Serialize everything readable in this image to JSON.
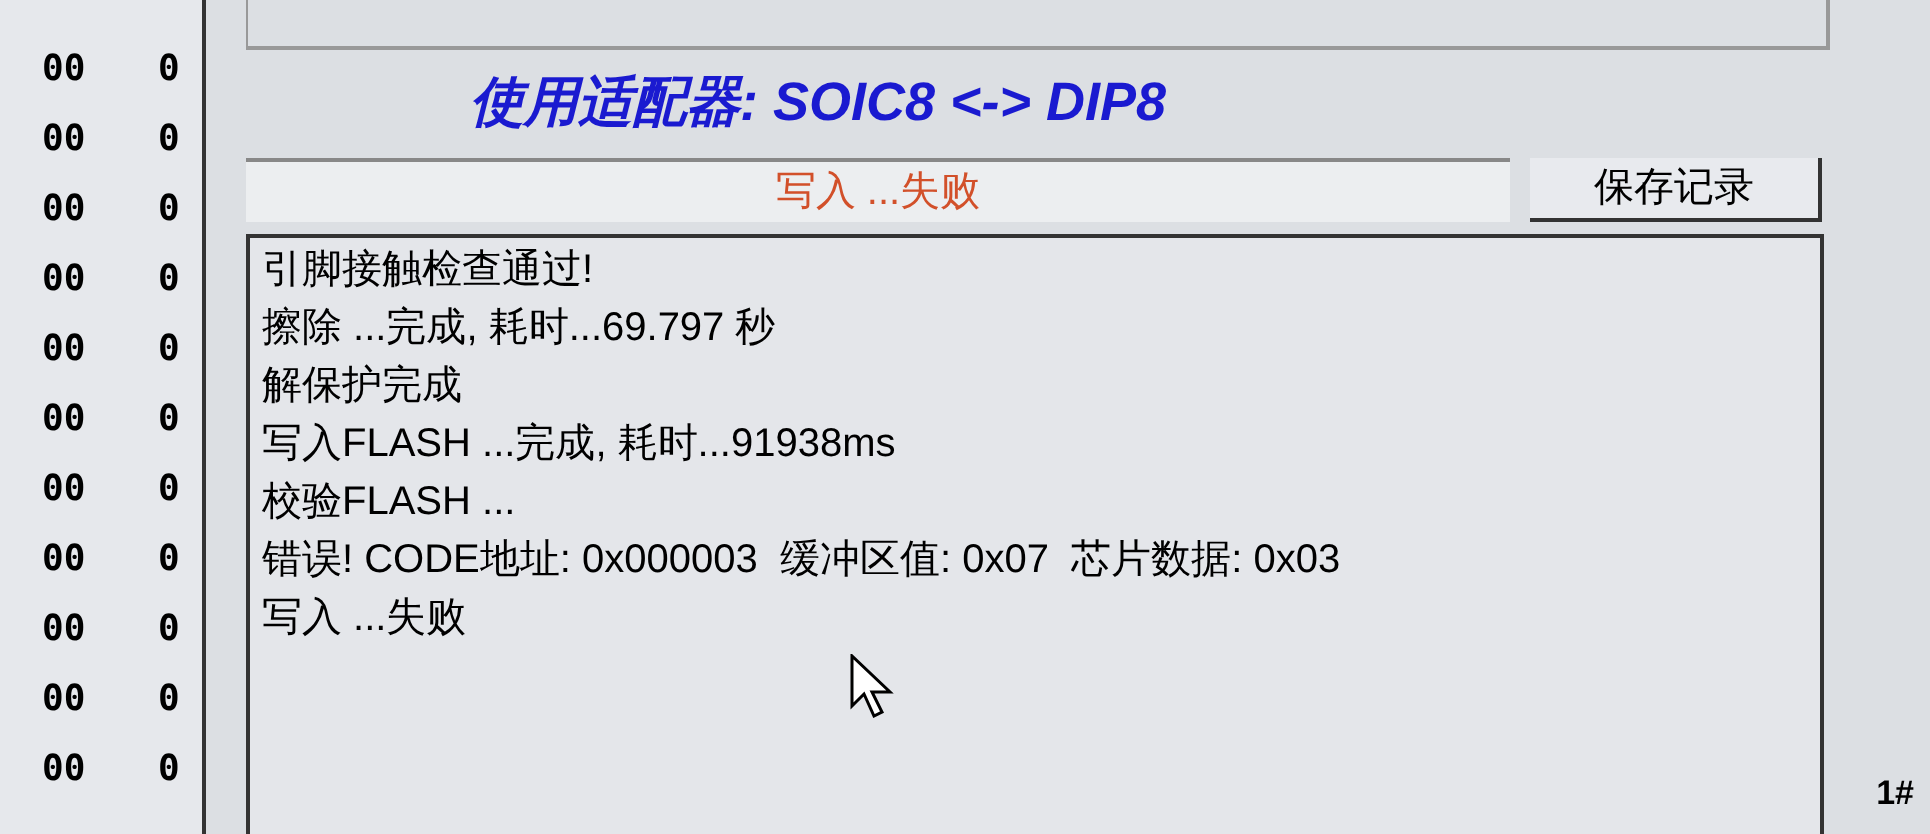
{
  "hex_rows": [
    [
      "00",
      "0"
    ],
    [
      "00",
      "0"
    ],
    [
      "00",
      "0"
    ],
    [
      "00",
      "0"
    ],
    [
      "00",
      "0"
    ],
    [
      "00",
      "0"
    ],
    [
      "00",
      "0"
    ],
    [
      "00",
      "0"
    ],
    [
      "00",
      "0"
    ],
    [
      "00",
      "0"
    ],
    [
      "00",
      "0"
    ]
  ],
  "adapter_title": "使用适配器: SOIC8 <-> DIP8",
  "status": {
    "text": "写入 ...失败",
    "color": "#d2502a"
  },
  "save_button": "保存记录",
  "log": [
    "引脚接触检查通过!",
    "擦除 ...完成, 耗时...69.797 秒",
    "解保护完成",
    "写入FLASH ...完成, 耗时...91938ms",
    "校验FLASH ...",
    "错误! CODE地址: 0x000003  缓冲区值: 0x07  芯片数据: 0x03",
    "写入 ...失败"
  ],
  "side_label": "1#"
}
